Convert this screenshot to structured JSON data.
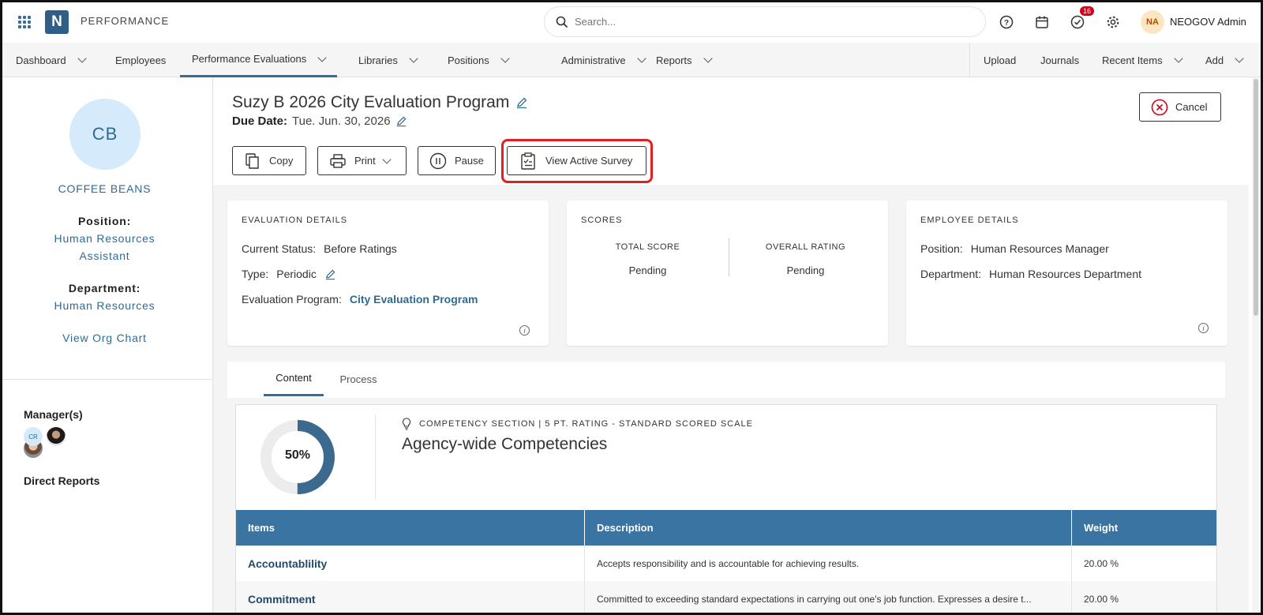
{
  "app": {
    "name": "PERFORMANCE",
    "logo_letter": "N"
  },
  "search": {
    "placeholder": "Search..."
  },
  "notifications": {
    "count": "16"
  },
  "user": {
    "initials": "NA",
    "name": "NEOGOV Admin"
  },
  "nav": {
    "items": [
      {
        "label": "Dashboard"
      },
      {
        "label": "Employees"
      },
      {
        "label": "Performance Evaluations"
      },
      {
        "label": "Libraries"
      },
      {
        "label": "Positions"
      },
      {
        "label": "Administrative"
      },
      {
        "label": "Reports"
      }
    ],
    "right": [
      {
        "label": "Upload"
      },
      {
        "label": "Journals"
      },
      {
        "label": "Recent Items"
      },
      {
        "label": "Add"
      }
    ]
  },
  "sidebar": {
    "initials": "CB",
    "name": "COFFEE BEANS",
    "position_label": "Position:",
    "position_line1": "Human Resources",
    "position_line2": "Assistant",
    "department_label": "Department:",
    "department": "Human Resources",
    "org_chart": "View Org Chart",
    "managers_label": "Manager(s)",
    "direct_reports_label": "Direct Reports",
    "report_initials": "CR"
  },
  "header": {
    "title": "Suzy B 2026 City Evaluation Program",
    "due_label": "Due Date:",
    "due_value": "Tue. Jun. 30, 2026",
    "buttons": {
      "copy": "Copy",
      "print": "Print",
      "pause": "Pause",
      "survey": "View Active Survey",
      "cancel": "Cancel"
    }
  },
  "evaluation_details": {
    "heading": "EVALUATION DETAILS",
    "status_label": "Current Status:",
    "status_value": "Before Ratings",
    "type_label": "Type:",
    "type_value": "Periodic",
    "program_label": "Evaluation Program:",
    "program_value": "City Evaluation Program"
  },
  "scores": {
    "heading": "SCORES",
    "total_label": "TOTAL SCORE",
    "total_value": "Pending",
    "overall_label": "OVERALL RATING",
    "overall_value": "Pending"
  },
  "employee_details": {
    "heading": "EMPLOYEE DETAILS",
    "position_label": "Position:",
    "position_value": "Human Resources Manager",
    "department_label": "Department:",
    "department_value": "Human Resources Department"
  },
  "tabs": [
    {
      "label": "Content"
    },
    {
      "label": "Process"
    }
  ],
  "section": {
    "progress_pct": 50,
    "progress_label": "50%",
    "subtitle": "COMPETENCY SECTION | 5 PT. RATING - STANDARD SCORED SCALE",
    "title": "Agency-wide Competencies",
    "columns": [
      "Items",
      "Description",
      "Weight"
    ],
    "rows": [
      {
        "item": "Accountablility",
        "description": "Accepts responsibility and is accountable for achieving results.",
        "weight": "20.00 %"
      },
      {
        "item": "Commitment",
        "description": "Committed to exceeding standard expectations in carrying out one's job function. Expresses a desire t...",
        "weight": "20.00 %"
      }
    ]
  },
  "colors": {
    "accent": "#2f6f99",
    "header_blue": "#3a74a2",
    "highlight": "#e21f1f",
    "cancel_red": "#d0021b"
  }
}
